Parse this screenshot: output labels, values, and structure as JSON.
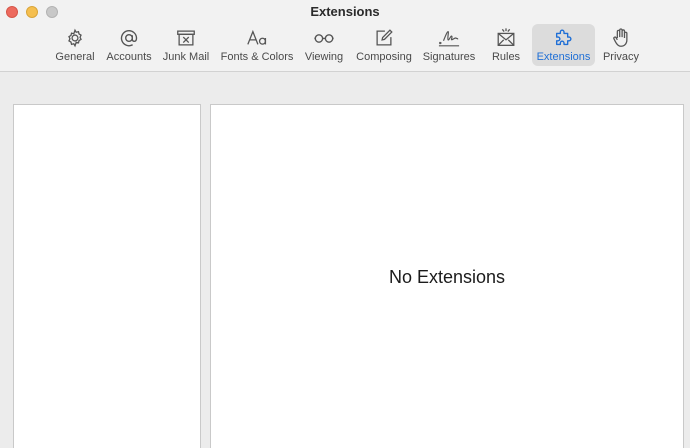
{
  "window": {
    "title": "Extensions",
    "buttons": {
      "close": "close",
      "minimize": "minimize",
      "zoom": "zoom"
    }
  },
  "toolbar": {
    "items": [
      {
        "label": "General",
        "icon": "gear-icon"
      },
      {
        "label": "Accounts",
        "icon": "at-sign-icon"
      },
      {
        "label": "Junk Mail",
        "icon": "junk-mail-icon"
      },
      {
        "label": "Fonts & Colors",
        "icon": "fonts-icon"
      },
      {
        "label": "Viewing",
        "icon": "glasses-icon"
      },
      {
        "label": "Composing",
        "icon": "compose-icon"
      },
      {
        "label": "Signatures",
        "icon": "signature-icon"
      },
      {
        "label": "Rules",
        "icon": "rules-icon"
      },
      {
        "label": "Extensions",
        "icon": "puzzle-icon"
      },
      {
        "label": "Privacy",
        "icon": "hand-icon"
      }
    ],
    "selected": "Extensions"
  },
  "content": {
    "empty_message": "No Extensions"
  },
  "colors": {
    "accent": "#1f6fd6",
    "close": "#ed6a5e",
    "minimize": "#f5bf4f",
    "zoom_inactive": "#c8c8c8"
  }
}
